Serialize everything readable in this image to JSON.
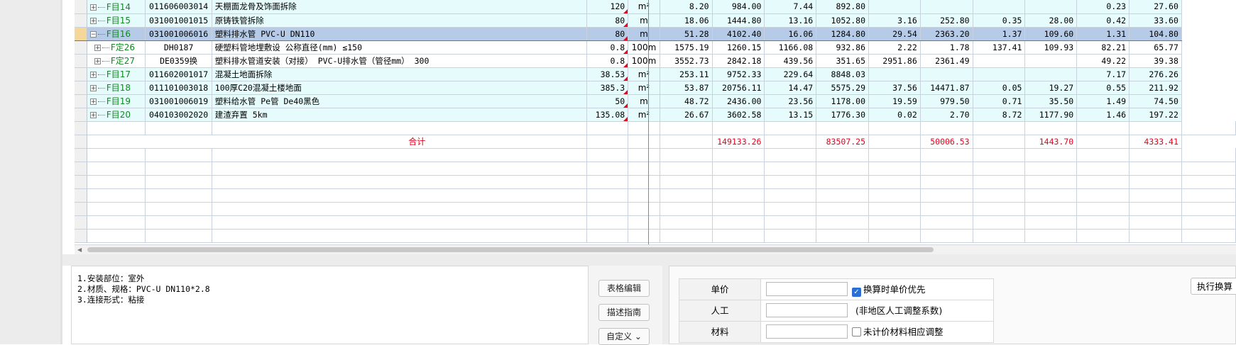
{
  "rows": [
    {
      "kind": "cyan",
      "tree": "+",
      "depth": 0,
      "name": "F目14",
      "code": "011606003014",
      "desc": "天棚面龙骨及饰面拆除",
      "qty": "120",
      "unit": "m²",
      "c1": "8.20",
      "c2": "984.00",
      "c3": "7.44",
      "c4": "892.80",
      "c5": "",
      "c6": "",
      "c7": "",
      "c8": "",
      "c9": "0.23",
      "c10": "27.60"
    },
    {
      "kind": "cyan",
      "tree": "+",
      "depth": 0,
      "name": "F目15",
      "code": "031001001015",
      "desc": "原铸铁管拆除",
      "qty": "80",
      "unit": "m",
      "c1": "18.06",
      "c2": "1444.80",
      "c3": "13.16",
      "c4": "1052.80",
      "c5": "3.16",
      "c6": "252.80",
      "c7": "0.35",
      "c8": "28.00",
      "c9": "0.42",
      "c10": "33.60"
    },
    {
      "kind": "sel",
      "tree": "−",
      "depth": 0,
      "name": "F目16",
      "code": "031001006016",
      "desc": "塑料排水管 PVC-U DN110",
      "qty": "80",
      "unit": "m",
      "c1": "51.28",
      "c2": "4102.40",
      "c3": "16.06",
      "c4": "1284.80",
      "c5": "29.54",
      "c6": "2363.20",
      "c7": "1.37",
      "c8": "109.60",
      "c9": "1.31",
      "c10": "104.80"
    },
    {
      "kind": "white",
      "tree": "+",
      "depth": 1,
      "name": "F定26",
      "code": "DH0187",
      "desc": "硬塑料管地埋敷设 公称直径(mm) ≤150",
      "qty": "0.8",
      "unit": "100m",
      "c1": "1575.19",
      "c2": "1260.15",
      "c3": "1166.08",
      "c4": "932.86",
      "c5": "2.22",
      "c6": "1.78",
      "c7": "137.41",
      "c8": "109.93",
      "c9": "82.21",
      "c10": "65.77"
    },
    {
      "kind": "white",
      "tree": "+",
      "depth": 1,
      "name": "F定27",
      "code": "DE0359换",
      "desc": "塑料排水管道安装（对接） PVC-U排水管（管径mm） 300",
      "qty": "0.8",
      "unit": "100m",
      "c1": "3552.73",
      "c2": "2842.18",
      "c3": "439.56",
      "c4": "351.65",
      "c5": "2951.86",
      "c6": "2361.49",
      "c7": "",
      "c8": "",
      "c9": "49.22",
      "c10": "39.38"
    },
    {
      "kind": "cyan",
      "tree": "+",
      "depth": 0,
      "name": "F目17",
      "code": "011602001017",
      "desc": "混凝土地面拆除",
      "qty": "38.53",
      "unit": "m²",
      "c1": "253.11",
      "c2": "9752.33",
      "c3": "229.64",
      "c4": "8848.03",
      "c5": "",
      "c6": "",
      "c7": "",
      "c8": "",
      "c9": "7.17",
      "c10": "276.26"
    },
    {
      "kind": "cyan",
      "tree": "+",
      "depth": 0,
      "name": "F目18",
      "code": "011101003018",
      "desc": "100厚C20混凝土楼地面",
      "qty": "385.3",
      "unit": "m²",
      "c1": "53.87",
      "c2": "20756.11",
      "c3": "14.47",
      "c4": "5575.29",
      "c5": "37.56",
      "c6": "14471.87",
      "c7": "0.05",
      "c8": "19.27",
      "c9": "0.55",
      "c10": "211.92"
    },
    {
      "kind": "cyan",
      "tree": "+",
      "depth": 0,
      "name": "F目19",
      "code": "031001006019",
      "desc": "塑料给水管 Pe管 De40黑色",
      "qty": "50",
      "unit": "m",
      "c1": "48.72",
      "c2": "2436.00",
      "c3": "23.56",
      "c4": "1178.00",
      "c5": "19.59",
      "c6": "979.50",
      "c7": "0.71",
      "c8": "35.50",
      "c9": "1.49",
      "c10": "74.50"
    },
    {
      "kind": "cyan",
      "tree": "+",
      "depth": 0,
      "name": "F目20",
      "code": "040103002020",
      "desc": "建渣弃置 5km",
      "qty": "135.08",
      "unit": "m²",
      "c1": "26.67",
      "c2": "3602.58",
      "c3": "13.15",
      "c4": "1776.30",
      "c5": "0.02",
      "c6": "2.70",
      "c7": "8.72",
      "c8": "1177.90",
      "c9": "1.46",
      "c10": "197.22"
    }
  ],
  "total": {
    "label": "合计",
    "c2": "149133.26",
    "c4": "83507.25",
    "c6": "50006.53",
    "c8": "1443.70",
    "c10": "4333.41"
  },
  "description_lines": [
    "1.安装部位：室外",
    "2.材质、规格：PVC-U DN110*2.8",
    "3.连接形式：粘接"
  ],
  "buttons": {
    "table_edit": "表格编辑",
    "desc_guide": "描述指南",
    "custom": "自定义 ⌄"
  },
  "adjust_form": {
    "unit_price_label": "单价",
    "unit_price_option": "换算时单价优先",
    "unit_price_checked": true,
    "labor_label": "人工",
    "labor_note": "(非地区人工调整系数)",
    "material_label": "材料",
    "material_option": "未计价材料相应调整",
    "material_checked": false
  },
  "execute_label": "执行换算"
}
